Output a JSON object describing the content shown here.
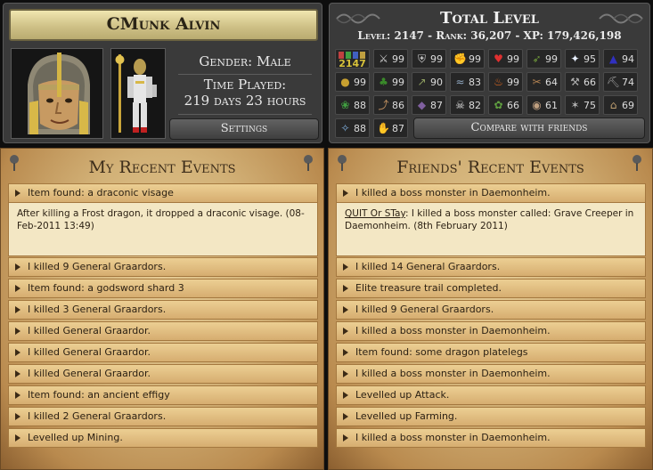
{
  "profile": {
    "name": "CMunk Alvin",
    "gender": "Gender: Male",
    "time_played_label": "Time Played:",
    "time_played_value": "219 days 23 hours",
    "settings_label": "Settings"
  },
  "skills": {
    "title": "Total Level",
    "stats": "Level: 2147 - Rank: 36,207 - XP: 179,426,198",
    "total": "2147",
    "levels": [
      {
        "icon": "attack-icon",
        "glyph": "⚔",
        "color": "#cfcfcf",
        "level": "99"
      },
      {
        "icon": "defence-icon",
        "glyph": "⛨",
        "color": "#d0d0d0",
        "level": "99"
      },
      {
        "icon": "strength-icon",
        "glyph": "✊",
        "color": "#d9b28a",
        "level": "99"
      },
      {
        "icon": "constitution-icon",
        "glyph": "♥",
        "color": "#e03030",
        "level": "99"
      },
      {
        "icon": "ranged-icon",
        "glyph": "➶",
        "color": "#6f9a3a",
        "level": "99"
      },
      {
        "icon": "prayer-icon",
        "glyph": "✦",
        "color": "#e8f0ff",
        "level": "95"
      },
      {
        "icon": "magic-icon",
        "glyph": "▲",
        "color": "#3030c0",
        "level": "94"
      },
      {
        "icon": "cooking-icon",
        "glyph": "●",
        "color": "#c8a030",
        "level": "99"
      },
      {
        "icon": "woodcutting-icon",
        "glyph": "♣",
        "color": "#3a8a2a",
        "level": "99"
      },
      {
        "icon": "fletching-icon",
        "glyph": "↗",
        "color": "#8fa060",
        "level": "90"
      },
      {
        "icon": "fishing-icon",
        "glyph": "≈",
        "color": "#90a8c0",
        "level": "83"
      },
      {
        "icon": "firemaking-icon",
        "glyph": "♨",
        "color": "#e06a20",
        "level": "99"
      },
      {
        "icon": "crafting-icon",
        "glyph": "✂",
        "color": "#b08050",
        "level": "64"
      },
      {
        "icon": "smithing-icon",
        "glyph": "⚒",
        "color": "#b0b0b0",
        "level": "66"
      },
      {
        "icon": "mining-icon",
        "glyph": "⛏",
        "color": "#a0a0a0",
        "level": "74"
      },
      {
        "icon": "herblore-icon",
        "glyph": "❀",
        "color": "#40a040",
        "level": "88"
      },
      {
        "icon": "agility-icon",
        "glyph": "⤴",
        "color": "#c09060",
        "level": "86"
      },
      {
        "icon": "thieving-icon",
        "glyph": "◆",
        "color": "#8060a0",
        "level": "87"
      },
      {
        "icon": "slayer-icon",
        "glyph": "☠",
        "color": "#e0e0e0",
        "level": "82"
      },
      {
        "icon": "farming-icon",
        "glyph": "✿",
        "color": "#60a040",
        "level": "66"
      },
      {
        "icon": "runecrafting-icon",
        "glyph": "◉",
        "color": "#c0a080",
        "level": "61"
      },
      {
        "icon": "hunter-icon",
        "glyph": "✶",
        "color": "#b0b0b0",
        "level": "75"
      },
      {
        "icon": "construction-icon",
        "glyph": "⌂",
        "color": "#c0a070",
        "level": "69"
      },
      {
        "icon": "summoning-icon",
        "glyph": "✧",
        "color": "#80b0e0",
        "level": "88"
      },
      {
        "icon": "dungeoneering-icon",
        "glyph": "✋",
        "color": "#d0a060",
        "level": "87"
      }
    ],
    "compare_label": "Compare with friends"
  },
  "my_events": {
    "title": "My Recent Events",
    "expanded_title": "Item found: a draconic visage",
    "expanded_detail": "After killing a Frost dragon, it dropped a draconic visage. (08-Feb-2011 13:49)",
    "items": [
      "I killed 9 General Graardors.",
      "Item found: a godsword shard 3",
      "I killed 3 General Graardors.",
      "I killed General Graardor.",
      "I killed General Graardor.",
      "I killed General Graardor.",
      "Item found: an ancient effigy",
      "I killed 2 General Graardors.",
      "Levelled up Mining."
    ]
  },
  "friends_events": {
    "title": "Friends' Recent Events",
    "expanded_title": "I killed a boss monster in Daemonheim.",
    "expanded_friend": "QUIT Or STay",
    "expanded_detail": ": I killed a boss monster called: Grave Creeper in Daemonheim. (8th February 2011)",
    "items": [
      "I killed 14 General Graardors.",
      "Elite treasure trail completed.",
      "I killed 9 General Graardors.",
      "I killed a boss monster in Daemonheim.",
      "Item found: some dragon platelegs",
      "I killed a boss monster in Daemonheim.",
      "Levelled up Attack.",
      "Levelled up Farming.",
      "I killed a boss monster in Daemonheim."
    ]
  }
}
